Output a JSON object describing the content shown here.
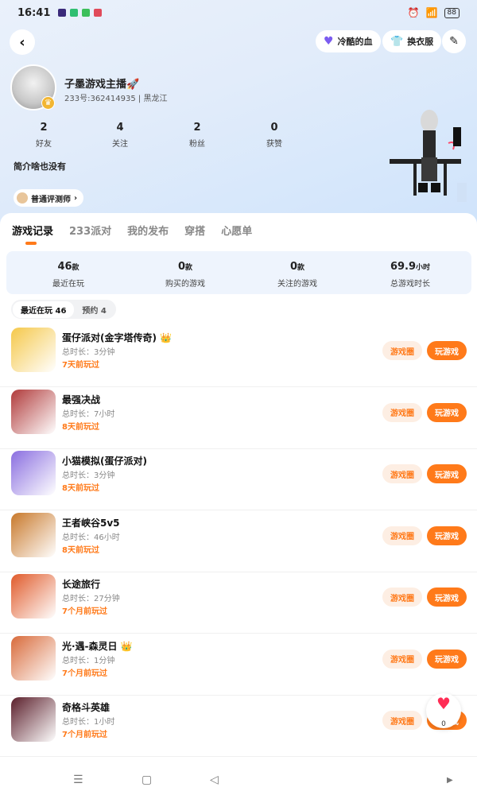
{
  "status_bar": {
    "time": "16:41",
    "battery": "88",
    "app_colors": [
      "#3a2a7a",
      "#2fbf71",
      "#3cbf5a",
      "#e04a5a"
    ]
  },
  "header": {
    "back_icon": "chevron-left-icon",
    "chip_blood": "冷酷的血",
    "chip_outfit": "换衣服",
    "edit_icon": "pencil-icon"
  },
  "profile": {
    "username": "子墨游戏主播🚀",
    "sub_info": "233号:362414935 | 黑龙江",
    "bio": "简介啥也没有",
    "tester_label": "普通评测师",
    "stats": [
      {
        "num": "2",
        "label": "好友"
      },
      {
        "num": "4",
        "label": "关注"
      },
      {
        "num": "2",
        "label": "粉丝"
      },
      {
        "num": "0",
        "label": "获赞"
      }
    ]
  },
  "tabs": [
    "游戏记录",
    "233派对",
    "我的发布",
    "穿搭",
    "心愿单"
  ],
  "summary": [
    {
      "num": "46",
      "unit": "款",
      "label": "最近在玩"
    },
    {
      "num": "0",
      "unit": "款",
      "label": "购买的游戏"
    },
    {
      "num": "0",
      "unit": "款",
      "label": "关注的游戏"
    },
    {
      "num": "69.9",
      "unit": "小时",
      "label": "总游戏时长"
    }
  ],
  "filters": [
    "最近在玩 46",
    "预约 4"
  ],
  "games": [
    {
      "title": "蛋仔派对(金字塔传奇)",
      "duration": "总时长：3分钟",
      "last": "7天前玩过",
      "crown": true,
      "color": "#f5c84a"
    },
    {
      "title": "最强决战",
      "duration": "总时长：7小时",
      "last": "8天前玩过",
      "crown": false,
      "color": "#b03a3a"
    },
    {
      "title": "小猫模拟(蛋仔派对)",
      "duration": "总时长：3分钟",
      "last": "8天前玩过",
      "crown": false,
      "color": "#8a6ee0"
    },
    {
      "title": "王者峡谷5v5",
      "duration": "总时长：46小时",
      "last": "8天前玩过",
      "crown": false,
      "color": "#c8782a"
    },
    {
      "title": "长途旅行",
      "duration": "总时长：27分钟",
      "last": "7个月前玩过",
      "crown": false,
      "color": "#e05a2a"
    },
    {
      "title": "光·遇-森灵日",
      "duration": "总时长：1分钟",
      "last": "7个月前玩过",
      "crown": true,
      "color": "#d86a3a"
    },
    {
      "title": "奇格斗英雄",
      "duration": "总时长：1小时",
      "last": "7个月前玩过",
      "crown": false,
      "color": "#5a1e2a"
    }
  ],
  "buttons": {
    "circle": "游戏圈",
    "play": "玩游戏"
  },
  "float_like": {
    "count": "0"
  },
  "nav": {
    "menu": "☰",
    "home": "▢",
    "back": "◁",
    "forward": "▶"
  }
}
